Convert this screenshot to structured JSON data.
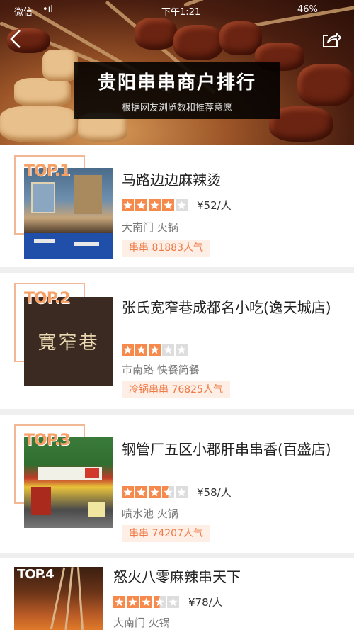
{
  "status": {
    "left": "微信",
    "signal": "•ıl",
    "time": "下午1:21",
    "battery": "46%"
  },
  "header": {
    "title": "贵阳串串商户排行",
    "subtitle": "根据网友浏览数和推荐意愿"
  },
  "accent": "#f07a45",
  "star_color": "#f58a4c",
  "items": [
    {
      "rank": "TOP.1",
      "name": "马路边边麻辣烫",
      "rating": 4,
      "price": "¥52/人",
      "location": "大南门 火锅",
      "tag": "串串 81883人气"
    },
    {
      "rank": "TOP.2",
      "name": "张氏宽窄巷成都名小吃(逸天城店)",
      "rating": 3,
      "price": "",
      "location": "市南路 快餐简餐",
      "tag": "冷锅串串 76825人气",
      "shop_sign": "寬窄巷"
    },
    {
      "rank": "TOP.3",
      "name": "钢管厂五区小郡肝串串香(百盛店)",
      "rating": 3.5,
      "price": "¥58/人",
      "location": "喷水池 火锅",
      "tag": "串串 74207人气"
    },
    {
      "rank": "TOP.4",
      "name": "怒火八零麻辣串天下",
      "rating": 3.5,
      "price": "¥78/人",
      "location": "大南门 火锅",
      "tag": ""
    }
  ]
}
